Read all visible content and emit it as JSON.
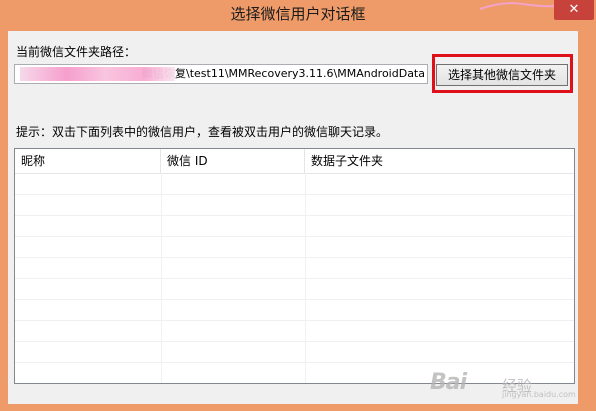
{
  "window": {
    "title": "选择微信用户对话框",
    "close_glyph": "✕",
    "titlebar_color": "#ef9b69",
    "close_color": "#c7423b"
  },
  "path": {
    "label": "当前微信文件夹路径：",
    "value": "微信恢复\\test11\\MMRecovery3.11.6\\MMAndroidData"
  },
  "other_folder_button": {
    "label": "选择其他微信文件夹",
    "highlight_color": "#e0101b"
  },
  "hint": "提示：双击下面列表中的微信用户，查看被双击用户的微信聊天记录。",
  "user_list": {
    "columns": [
      "昵称",
      "微信 ID",
      "数据子文件夹"
    ],
    "rows": []
  },
  "watermark": {
    "logo": "Bai",
    "sub": "经验",
    "url": "jingyan.baidu.com"
  }
}
